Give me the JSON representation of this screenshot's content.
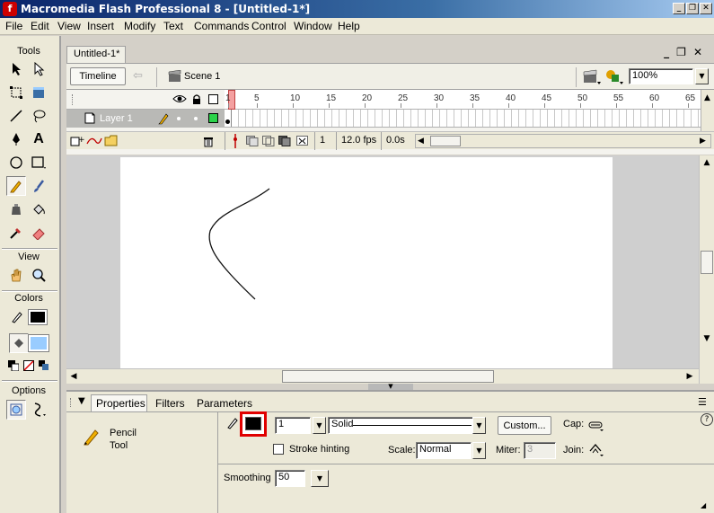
{
  "window": {
    "title": "Macromedia Flash Professional 8 - [Untitled-1*]",
    "controls": [
      "_",
      "❐",
      "✕"
    ]
  },
  "menu": [
    "File",
    "Edit",
    "View",
    "Insert",
    "Modify",
    "Text",
    "Commands",
    "Control",
    "Window",
    "Help"
  ],
  "tools": {
    "header": "Tools",
    "view_header": "View",
    "colors_header": "Colors",
    "options_header": "Options",
    "selected_tool": "pencil-icon",
    "stroke_color": "#000000",
    "fill_color": "#99ccff"
  },
  "document": {
    "tab_label": "Untitled-1*",
    "timeline_button": "Timeline",
    "scene_label": "Scene 1",
    "zoom": "100%",
    "doc_controls": [
      "_",
      "❐",
      "✕"
    ]
  },
  "timeline": {
    "layer_name": "Layer 1",
    "frame_numbers": [
      "1",
      "5",
      "10",
      "15",
      "20",
      "25",
      "30",
      "35",
      "40",
      "45",
      "50",
      "55",
      "60",
      "65"
    ],
    "current_frame": "1",
    "frame_rate": "12.0 fps",
    "elapsed_time": "0.0s"
  },
  "properties": {
    "tabs": [
      "Properties",
      "Filters",
      "Parameters"
    ],
    "tool_name_line1": "Pencil",
    "tool_name_line2": "Tool",
    "stroke_color": "#000000",
    "stroke_height": "1",
    "stroke_style": "Solid",
    "custom_button": "Custom...",
    "cap_label": "Cap:",
    "stroke_hinting_label": "Stroke hinting",
    "stroke_hinting_checked": false,
    "scale_label": "Scale:",
    "scale_value": "Normal",
    "miter_label": "Miter:",
    "miter_value": "3",
    "join_label": "Join:",
    "smoothing_label": "Smoothing",
    "smoothing_value": "50",
    "help_icon": "?"
  }
}
